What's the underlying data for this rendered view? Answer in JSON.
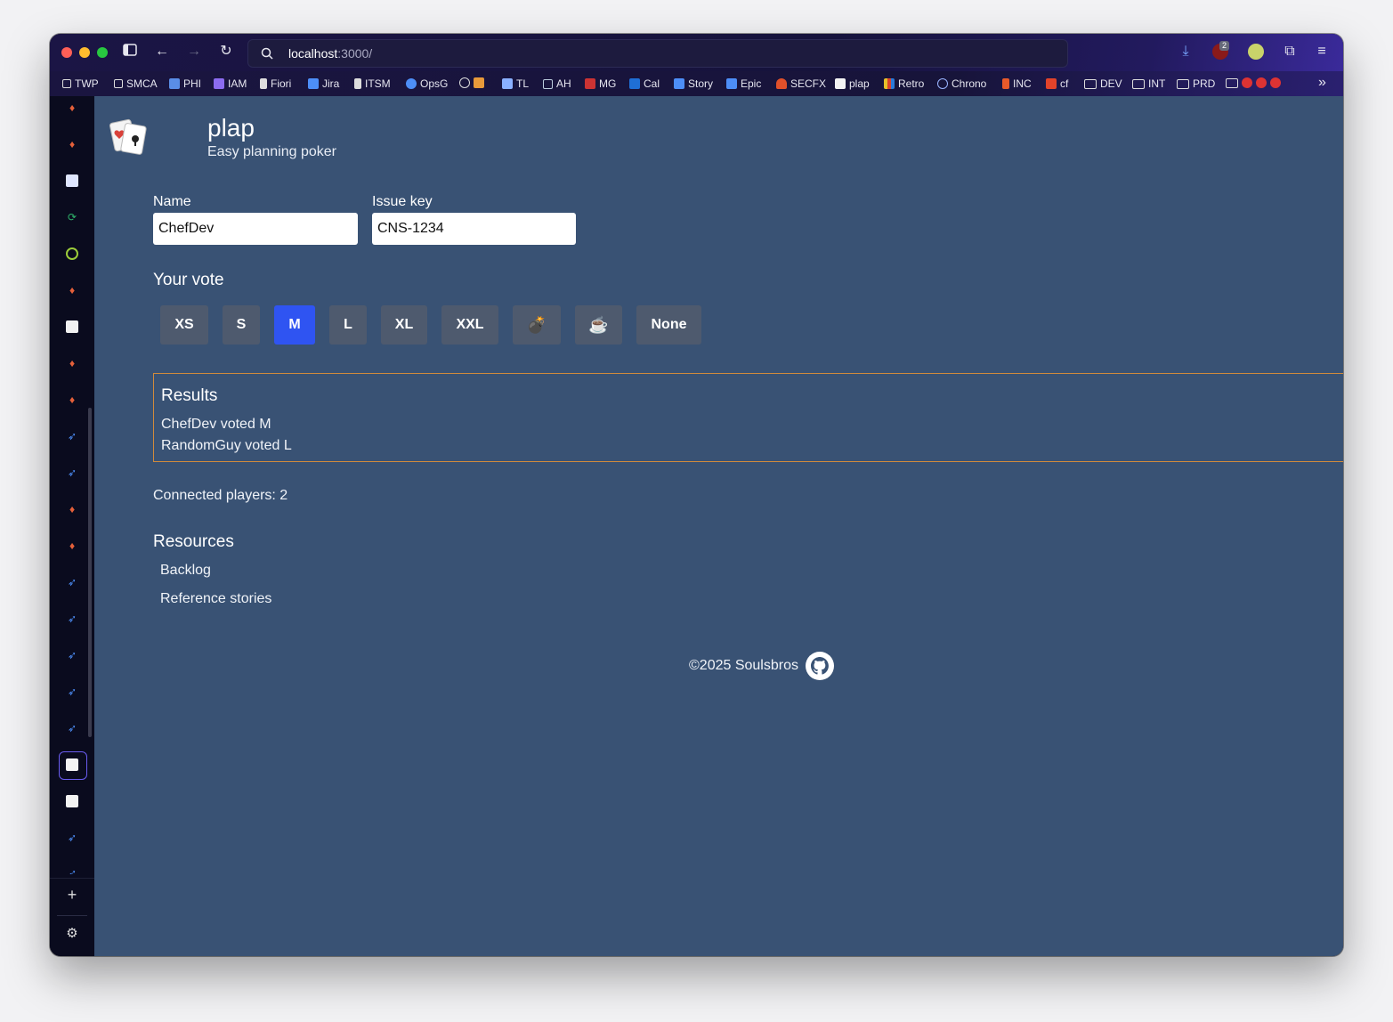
{
  "browser": {
    "url_host": "localhost",
    "url_path": ":3000/",
    "download_badge": "2"
  },
  "bookmarks": [
    {
      "label": "TWP",
      "icon": "lock-icon"
    },
    {
      "label": "SMCA",
      "icon": "lock-icon"
    },
    {
      "label": "PHI",
      "icon": "hexagon-icon"
    },
    {
      "label": "IAM",
      "icon": "triangle-icon"
    },
    {
      "label": "Fiori",
      "icon": "page-icon"
    },
    {
      "label": "Jira",
      "icon": "jira-icon"
    },
    {
      "label": "ITSM",
      "icon": "page-icon"
    },
    {
      "label": "OpsG",
      "icon": "opsgenie-icon"
    },
    {
      "label": "",
      "icon": "globe-icon"
    },
    {
      "label": "TL",
      "icon": "tl-icon"
    },
    {
      "label": "AH",
      "icon": "hex-outline-icon"
    },
    {
      "label": "MG",
      "icon": "mg-icon"
    },
    {
      "label": "Cal",
      "icon": "outlook-icon"
    },
    {
      "label": "Story",
      "icon": "jira-icon"
    },
    {
      "label": "Epic",
      "icon": "jira-icon"
    },
    {
      "label": "SECFX",
      "icon": "flame-icon"
    },
    {
      "label": "plap",
      "icon": "cards-icon"
    },
    {
      "label": "Retro",
      "icon": "retro-icon"
    },
    {
      "label": "Chrono",
      "icon": "chrono-icon"
    },
    {
      "label": "INC",
      "icon": "inc-icon"
    },
    {
      "label": "cf",
      "icon": "gitlab-icon"
    },
    {
      "label": "DEV",
      "icon": "folder-icon"
    },
    {
      "label": "INT",
      "icon": "folder-icon"
    },
    {
      "label": "PRD",
      "icon": "folder-icon"
    }
  ],
  "app": {
    "title": "plap",
    "subtitle": "Easy planning poker"
  },
  "form": {
    "name_label": "Name",
    "name_value": "ChefDev",
    "issue_label": "Issue key",
    "issue_value": "CNS-1234"
  },
  "vote": {
    "heading": "Your vote",
    "options": [
      "XS",
      "S",
      "M",
      "L",
      "XL",
      "XXL",
      "💣",
      "☕",
      "None"
    ],
    "selected": "M"
  },
  "results": {
    "title": "Results",
    "lines": [
      "ChefDev voted M",
      "RandomGuy voted L"
    ]
  },
  "connected": "Connected players: 2",
  "resources": {
    "heading": "Resources",
    "links": [
      "Backlog",
      "Reference stories"
    ]
  },
  "footer": {
    "copyright": "©2025 Soulsbros",
    "icon": "github-icon"
  },
  "colors": {
    "page_bg": "#395274",
    "selected_vote": "#2f54f2",
    "vote_button": "#4e5a6e",
    "results_border": "#d08a3c"
  }
}
